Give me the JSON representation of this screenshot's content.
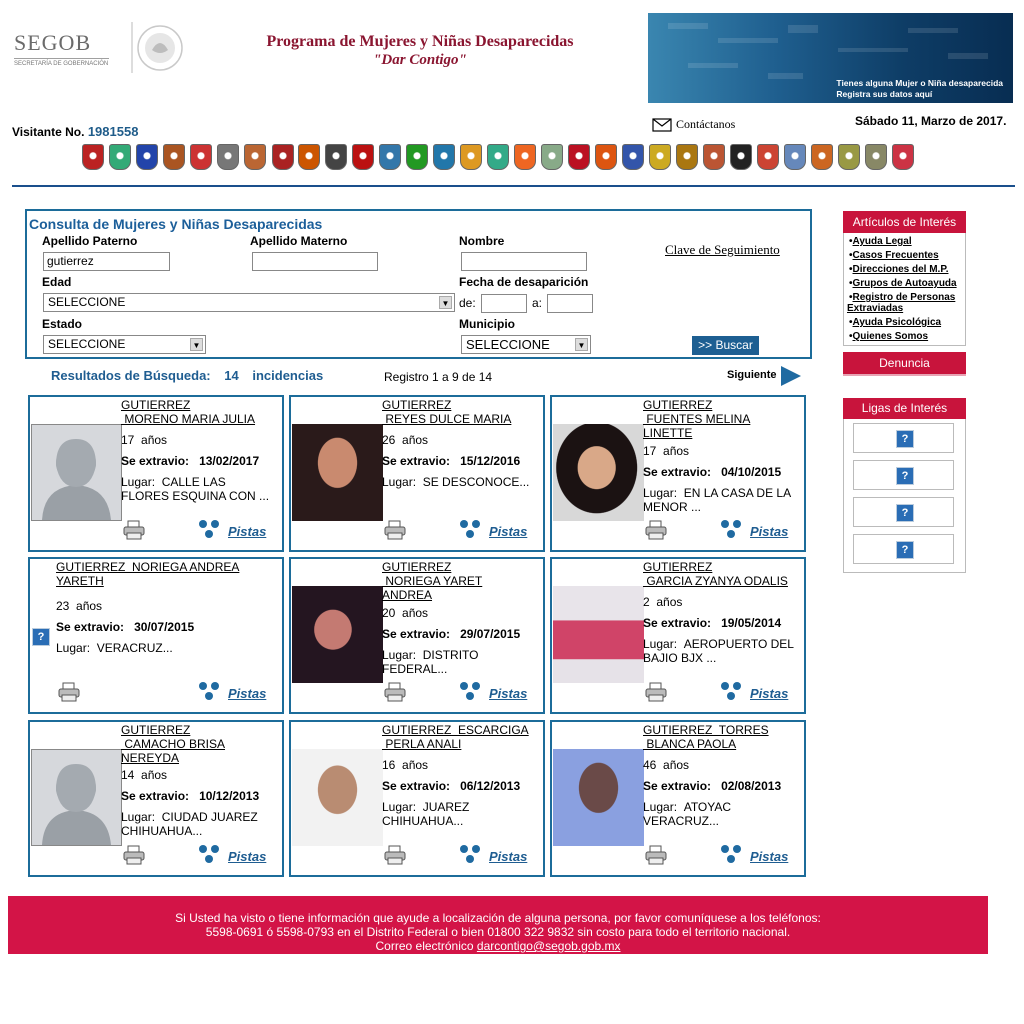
{
  "header": {
    "logo_word": "SEGOB",
    "logo_sub": "SECRETARÍA DE GOBERNACIÓN",
    "program_title": "Programa de Mujeres y Niñas Desaparecidas",
    "program_subtitle": "\"Dar Contigo\"",
    "banner_line1": "Tienes alguna Mujer o Niña desaparecida",
    "banner_line2": "Registra sus datos aquí",
    "visitor_label": "Visitante No.",
    "visitor_number": "1981558",
    "contact_label": "Contáctanos",
    "date": "Sábado 11, Marzo de 2017."
  },
  "search": {
    "title": "Consulta de Mujeres y Niñas Desaparecidas",
    "apellido_paterno_label": "Apellido Paterno",
    "apellido_paterno_value": "gutierrez",
    "apellido_materno_label": "Apellido Materno",
    "apellido_materno_value": "",
    "nombre_label": "Nombre",
    "nombre_value": "",
    "clave_link": "Clave de Seguimiento",
    "edad_label": "Edad",
    "edad_value": "SELECCIONE",
    "fecha_label": "Fecha de desaparición",
    "de_label": "de:",
    "a_label": "a:",
    "estado_label": "Estado",
    "estado_value": "SELECCIONE",
    "municipio_label": "Municipio",
    "municipio_value": "SELECCIONE",
    "buscar_label": ">> Buscar"
  },
  "results": {
    "label": "Resultados de Búsqueda:",
    "count": "14",
    "incidencias": "incidencias",
    "registro": "Registro 1 a 9 de 14",
    "siguiente": "Siguiente"
  },
  "card_labels": {
    "anos": "años",
    "se_extravio": "Se extravio:",
    "lugar": "Lugar:",
    "pistas": "Pistas"
  },
  "cards": [
    {
      "name1": "GUTIERREZ",
      "name2": " MORENO MARIA JULIA",
      "name3": "",
      "age": "17",
      "date": "13/02/2017",
      "lugar1": "CALLE LAS",
      "lugar2": "FLORES ESQUINA CON ..."
    },
    {
      "name1": "GUTIERREZ",
      "name2": " REYES DULCE MARIA",
      "name3": "",
      "age": "26",
      "date": "15/12/2016",
      "lugar1": "SE DESCONOCE...",
      "lugar2": ""
    },
    {
      "name1": "GUTIERREZ",
      "name2": " FUENTES MELINA",
      "name3": "LINETTE",
      "age": "17",
      "date": "04/10/2015",
      "lugar1": "EN LA CASA DE LA",
      "lugar2": "MENOR ..."
    },
    {
      "name1": "GUTIERREZ  NORIEGA ANDREA",
      "name2": "YARETH",
      "name3": "",
      "age": "23",
      "date": "30/07/2015",
      "lugar1": "VERACRUZ...",
      "lugar2": ""
    },
    {
      "name1": "GUTIERREZ",
      "name2": " NORIEGA YARET",
      "name3": "ANDREA",
      "age": "20",
      "date": "29/07/2015",
      "lugar1": "DISTRITO",
      "lugar2": "FEDERAL..."
    },
    {
      "name1": "GUTIERREZ",
      "name2": " GARCIA ZYANYA ODALIS",
      "name3": "",
      "age": "2",
      "date": "19/05/2014",
      "lugar1": "AEROPUERTO DEL",
      "lugar2": "BAJIO BJX ..."
    },
    {
      "name1": "GUTIERREZ",
      "name2": " CAMACHO BRISA",
      "name3": "NEREYDA",
      "age": "14",
      "date": "10/12/2013",
      "lugar1": "CIUDAD JUAREZ",
      "lugar2": "CHIHUAHUA..."
    },
    {
      "name1": "GUTIERREZ  ESCARCIGA",
      "name2": " PERLA ANALI",
      "name3": "",
      "age": "16",
      "date": "06/12/2013",
      "lugar1": "JUAREZ",
      "lugar2": "CHIHUAHUA..."
    },
    {
      "name1": "GUTIERREZ  TORRES",
      "name2": " BLANCA PAOLA",
      "name3": "",
      "age": "46",
      "date": "02/08/2013",
      "lugar1": "ATOYAC",
      "lugar2": "VERACRUZ..."
    }
  ],
  "sidebar": {
    "articulos_title": "Artículos de Interés",
    "articulos": [
      "Ayuda Legal",
      "Casos Frecuentes",
      "Direcciones del M.P.",
      "Grupos de Autoayuda",
      "Registro de Personas",
      "Extraviadas",
      "Ayuda Psicológica",
      "Quienes Somos"
    ],
    "denuncia": "Denuncia",
    "ligas_title": "Ligas de Interés"
  },
  "footer": {
    "line1": "Si Usted ha visto o tiene información que ayude a localización de alguna persona, por favor comuníquese a los teléfonos:",
    "line2": "5598-0691 ó 5598-0793 en el Distrito Federal o bien 01800 322 9832 sin costo para todo el territorio nacional.",
    "email_label": "Correo electrónico",
    "email": "darcontigo@segob.gob.mx"
  },
  "colors": {
    "brand_blue": "#1c6c9a",
    "accent_red": "#c8143c",
    "footer_red": "#d31447",
    "title_burgundy": "#8a1530"
  }
}
